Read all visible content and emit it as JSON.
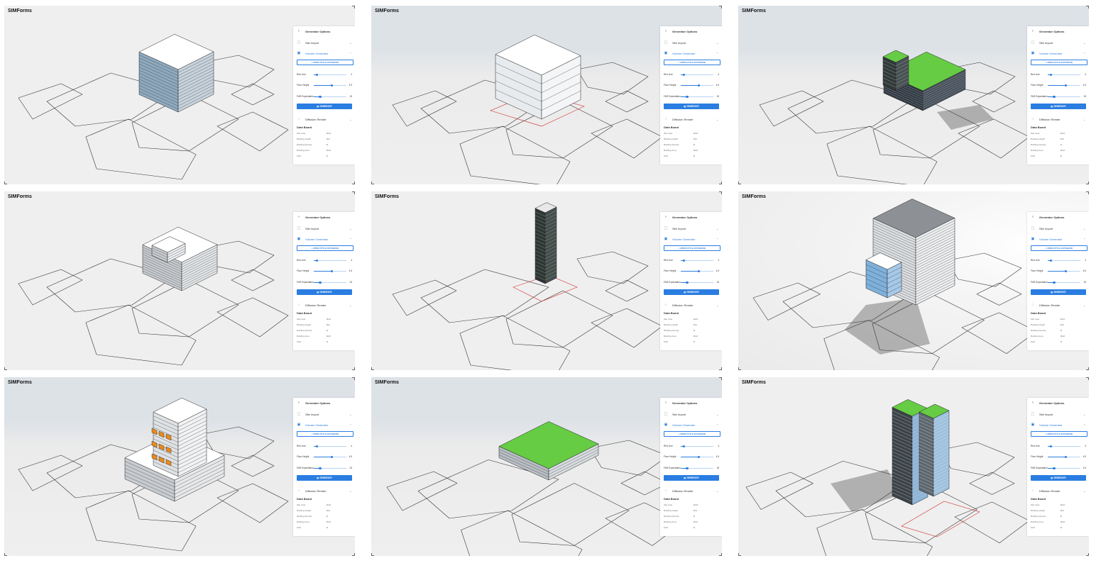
{
  "app_title": "SIMForms",
  "panel": {
    "header_label": "Generator Options",
    "site_import_label": "Site Import",
    "volume_generator_label": "Volume Generator",
    "open_style_db_label": "OPEN STYLE DATABASE",
    "sliders": [
      {
        "label": "Red Line",
        "value": "4",
        "fraction": 0.1
      },
      {
        "label": "Floor Height",
        "value": "4.5",
        "fraction": 0.55
      },
      {
        "label": "FAR Expectation",
        "value": "15",
        "fraction": 0.2
      }
    ],
    "generate_label": "GENERATE",
    "diffusion_render_label": "Diffusion Render",
    "data_board_title": "Data Board",
    "data_board": [
      {
        "key": "Site Area",
        "value": "0 m²"
      },
      {
        "key": "Building Height",
        "value": "0 m"
      },
      {
        "key": "Building Density",
        "value": "0"
      },
      {
        "key": "Building Area",
        "value": "0 m²"
      },
      {
        "key": "FAR",
        "value": "0"
      }
    ]
  },
  "tiles": [
    {
      "id": 1,
      "style": "plain",
      "building": "glass-box"
    },
    {
      "id": 2,
      "style": "sky",
      "building": "white-frame"
    },
    {
      "id": 3,
      "style": "sky",
      "building": "green-roof-terrace"
    },
    {
      "id": 4,
      "style": "plain",
      "building": "stepped-mass"
    },
    {
      "id": 5,
      "style": "plain",
      "building": "green-tower"
    },
    {
      "id": 6,
      "style": "glow",
      "building": "grey-curved-block"
    },
    {
      "id": 7,
      "style": "sky",
      "building": "orange-balconies"
    },
    {
      "id": 8,
      "style": "sky",
      "building": "green-flat-roof"
    },
    {
      "id": 9,
      "style": "plain",
      "building": "twin-towers"
    }
  ],
  "tile9_far_value": "4.5",
  "colors": {
    "accent": "#2a7de1",
    "green_roof": "#66cc44",
    "orange": "#e98a1b",
    "redline": "#d03030"
  }
}
